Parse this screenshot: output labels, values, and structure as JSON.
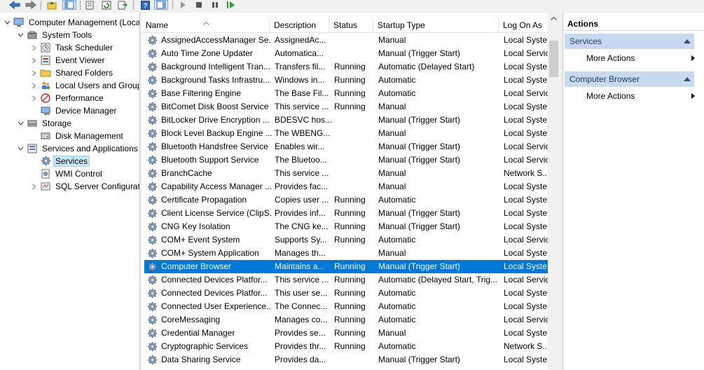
{
  "tree": [
    {
      "label": "Computer Management (Local",
      "icon": "computer-management-icon",
      "expander": "expanded",
      "level": 0
    },
    {
      "label": "System Tools",
      "icon": "toolbox-icon",
      "expander": "expanded",
      "level": 1
    },
    {
      "label": "Task Scheduler",
      "icon": "clock-icon",
      "expander": "collapsed",
      "level": 2
    },
    {
      "label": "Event Viewer",
      "icon": "event-viewer-icon",
      "expander": "collapsed",
      "level": 2
    },
    {
      "label": "Shared Folders",
      "icon": "folder-icon",
      "expander": "collapsed",
      "level": 2
    },
    {
      "label": "Local Users and Groups",
      "icon": "users-icon",
      "expander": "collapsed",
      "level": 2
    },
    {
      "label": "Performance",
      "icon": "performance-icon",
      "expander": "collapsed",
      "level": 2
    },
    {
      "label": "Device Manager",
      "icon": "device-manager-icon",
      "expander": "none",
      "level": 2
    },
    {
      "label": "Storage",
      "icon": "storage-icon",
      "expander": "expanded",
      "level": 1
    },
    {
      "label": "Disk Management",
      "icon": "disk-icon",
      "expander": "none",
      "level": 2
    },
    {
      "label": "Services and Applications",
      "icon": "services-apps-icon",
      "expander": "expanded",
      "level": 1
    },
    {
      "label": "Services",
      "icon": "gear-icon",
      "expander": "none",
      "level": 2,
      "selected": true
    },
    {
      "label": "WMI Control",
      "icon": "wmi-icon",
      "expander": "none",
      "level": 2
    },
    {
      "label": "SQL Server Configuratic",
      "icon": "sql-icon",
      "expander": "collapsed",
      "level": 2
    }
  ],
  "columns": [
    "Name",
    "Description",
    "Status",
    "Startup Type",
    "Log On As"
  ],
  "services": [
    [
      "AssignedAccessManager Se...",
      "AssignedAc...",
      "",
      "Manual",
      "Local Syste..."
    ],
    [
      "Auto Time Zone Updater",
      "Automatica...",
      "",
      "Manual (Trigger Start)",
      "Local Servic"
    ],
    [
      "Background Intelligent Tran...",
      "Transfers fil...",
      "Running",
      "Automatic (Delayed Start)",
      "Local Syste..."
    ],
    [
      "Background Tasks Infrastru...",
      "Windows in...",
      "Running",
      "Automatic",
      "Local Syste..."
    ],
    [
      "Base Filtering Engine",
      "The Base Fil...",
      "Running",
      "Automatic",
      "Local Servic"
    ],
    [
      "BitComet Disk Boost Service",
      "This service ...",
      "Running",
      "Manual",
      "Local Syste..."
    ],
    [
      "BitLocker Drive Encryption ...",
      "BDESVC hos...",
      "",
      "Manual (Trigger Start)",
      "Local Syste..."
    ],
    [
      "Block Level Backup Engine ...",
      "The WBENG...",
      "",
      "Manual",
      "Local Syste..."
    ],
    [
      "Bluetooth Handsfree Service",
      "Enables wir...",
      "",
      "Manual (Trigger Start)",
      "Local Servic"
    ],
    [
      "Bluetooth Support Service",
      "The Bluetoo...",
      "",
      "Manual (Trigger Start)",
      "Local Servic"
    ],
    [
      "BranchCache",
      "This service ...",
      "",
      "Manual",
      "Network S..."
    ],
    [
      "Capability Access Manager ...",
      "Provides fac...",
      "",
      "Manual",
      "Local Syste..."
    ],
    [
      "Certificate Propagation",
      "Copies user ...",
      "Running",
      "Automatic",
      "Local Syste..."
    ],
    [
      "Client License Service (ClipS...",
      "Provides inf...",
      "Running",
      "Manual (Trigger Start)",
      "Local Syste..."
    ],
    [
      "CNG Key Isolation",
      "The CNG ke...",
      "Running",
      "Manual (Trigger Start)",
      "Local Syste..."
    ],
    [
      "COM+ Event System",
      "Supports Sy...",
      "Running",
      "Automatic",
      "Local Servic"
    ],
    [
      "COM+ System Application",
      "Manages th...",
      "",
      "Manual",
      "Local Syste..."
    ],
    [
      "Computer Browser",
      "Maintains a...",
      "Running",
      "Manual (Trigger Start)",
      "Local Syste..."
    ],
    [
      "Connected Devices Platfor...",
      "This service ...",
      "Running",
      "Automatic (Delayed Start, Trig...",
      "Local Servic"
    ],
    [
      "Connected Devices Platfor...",
      "This user se...",
      "Running",
      "Automatic",
      "Local Syste..."
    ],
    [
      "Connected User Experience...",
      "The Connec...",
      "Running",
      "Automatic",
      "Local Syste..."
    ],
    [
      "CoreMessaging",
      "Manages co...",
      "Running",
      "Automatic",
      "Local Servic"
    ],
    [
      "Credential Manager",
      "Provides se...",
      "Running",
      "Manual",
      "Local Syste..."
    ],
    [
      "Cryptographic Services",
      "Provides thr...",
      "Running",
      "Automatic",
      "Network S..."
    ],
    [
      "Data Sharing Service",
      "Provides da...",
      "",
      "Manual (Trigger Start)",
      "Local Syste..."
    ]
  ],
  "selected_service_index": 17,
  "actions": {
    "title": "Actions",
    "sections": [
      {
        "label": "Services",
        "items": [
          "More Actions"
        ]
      },
      {
        "label": "Computer Browser",
        "items": [
          "More Actions"
        ]
      }
    ]
  },
  "colors": {
    "selection": "#0078d7",
    "tree_selection": "#cce8ff",
    "action_header": "#c8daf0"
  }
}
